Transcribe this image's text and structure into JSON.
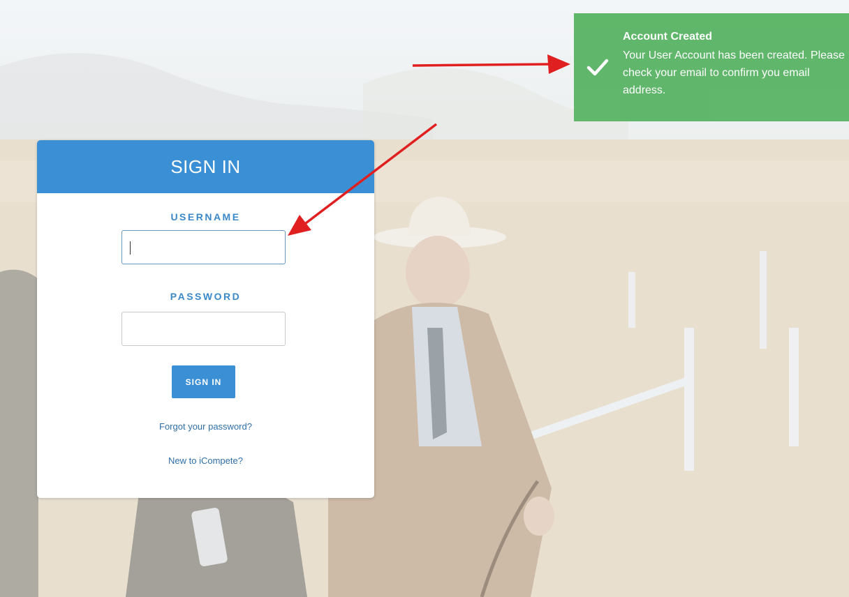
{
  "signin": {
    "header_title": "SIGN IN",
    "username_label": "USERNAME",
    "username_value": "",
    "password_label": "PASSWORD",
    "password_value": "",
    "submit_label": "SIGN IN",
    "forgot_link": "Forgot your password?",
    "new_user_link": "New to iCompete?"
  },
  "toast": {
    "title": "Account Created",
    "message": "Your User Account has been created. Please check your email to confirm you email address.",
    "icon": "checkmark-icon",
    "color": "#5cb566"
  },
  "colors": {
    "primary": "#3b8fd4",
    "annotation_arrow": "#e02020"
  }
}
